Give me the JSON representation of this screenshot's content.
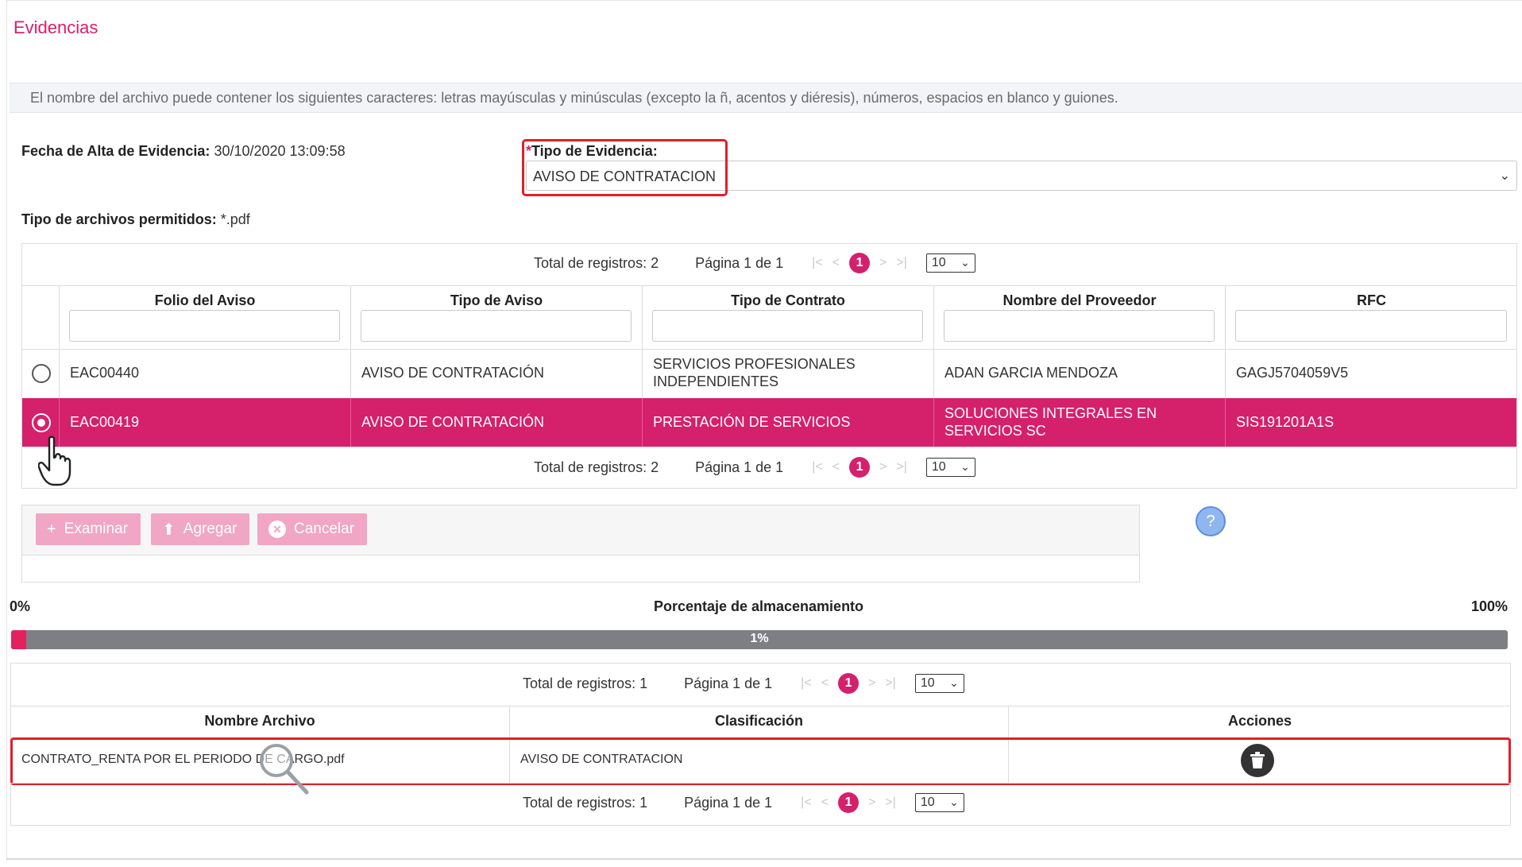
{
  "section": {
    "title": "Evidencias"
  },
  "info_banner": "El nombre del archivo puede contener los siguientes caracteres: letras mayúsculas y minúsculas (excepto la ñ, acentos y diéresis), números, espacios en blanco y guiones.",
  "fecha_alta": {
    "label": "Fecha de Alta de Evidencia:",
    "value": "30/10/2020 13:09:58"
  },
  "tipo_evidencia": {
    "required_mark": "*",
    "label": "Tipo de Evidencia:",
    "value": "AVISO DE CONTRATACION"
  },
  "tipos_permitidos": {
    "label": "Tipo de archivos permitidos:",
    "value": "*.pdf"
  },
  "avisos_table": {
    "pager": {
      "total": "Total de registros: 2",
      "page": "Página 1 de 1",
      "current": "1",
      "size": "10"
    },
    "columns": [
      "Folio del Aviso",
      "Tipo de Aviso",
      "Tipo de Contrato",
      "Nombre del Proveedor",
      "RFC"
    ],
    "rows": [
      {
        "selected": false,
        "folio": "EAC00440",
        "tipo_aviso": "AVISO DE CONTRATACIÓN",
        "tipo_contrato": "SERVICIOS PROFESIONALES INDEPENDIENTES",
        "proveedor": "ADAN GARCIA MENDOZA",
        "rfc": "GAGJ5704059V5"
      },
      {
        "selected": true,
        "folio": "EAC00419",
        "tipo_aviso": "AVISO DE CONTRATACIÓN",
        "tipo_contrato": "PRESTACIÓN DE SERVICIOS",
        "proveedor": "SOLUCIONES INTEGRALES EN SERVICIOS SC",
        "rfc": "SIS191201A1S"
      }
    ]
  },
  "upload": {
    "browse_label": "Examinar",
    "add_label": "Agregar",
    "cancel_label": "Cancelar",
    "help_label": "?"
  },
  "storage": {
    "min_label": "0%",
    "title": "Porcentaje de almacenamiento",
    "max_label": "100%",
    "percent_text": "1%",
    "percent_value": 1
  },
  "files_table": {
    "pager": {
      "total": "Total de registros: 1",
      "page": "Página 1 de 1",
      "current": "1",
      "size": "10"
    },
    "columns": [
      "Nombre Archivo",
      "Clasificación",
      "Acciones"
    ],
    "rows": [
      {
        "nombre": "CONTRATO_RENTA POR EL PERIODO DE CARGO.pdf",
        "clasificacion": "AVISO DE CONTRATACION"
      }
    ]
  },
  "colors": {
    "accent": "#d5206c",
    "highlight_box": "#e0202a",
    "bar_track": "#7d7f82"
  },
  "icons": {
    "browse": "plus-icon",
    "add": "upload-icon",
    "cancel": "close-circle-icon",
    "help": "question-icon",
    "delete": "trash-icon",
    "pointer": "hand-cursor-icon",
    "zoom": "magnifier-icon"
  }
}
